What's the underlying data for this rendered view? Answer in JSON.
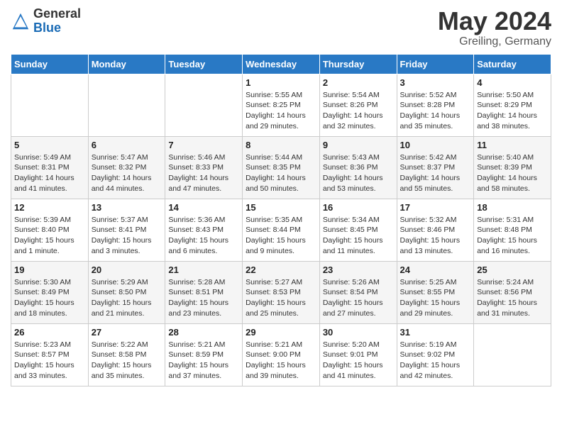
{
  "header": {
    "logo_general": "General",
    "logo_blue": "Blue",
    "title": "May 2024",
    "location": "Greiling, Germany"
  },
  "days_of_week": [
    "Sunday",
    "Monday",
    "Tuesday",
    "Wednesday",
    "Thursday",
    "Friday",
    "Saturday"
  ],
  "weeks": [
    [
      {
        "day": "",
        "info": ""
      },
      {
        "day": "",
        "info": ""
      },
      {
        "day": "",
        "info": ""
      },
      {
        "day": "1",
        "info": "Sunrise: 5:55 AM\nSunset: 8:25 PM\nDaylight: 14 hours\nand 29 minutes."
      },
      {
        "day": "2",
        "info": "Sunrise: 5:54 AM\nSunset: 8:26 PM\nDaylight: 14 hours\nand 32 minutes."
      },
      {
        "day": "3",
        "info": "Sunrise: 5:52 AM\nSunset: 8:28 PM\nDaylight: 14 hours\nand 35 minutes."
      },
      {
        "day": "4",
        "info": "Sunrise: 5:50 AM\nSunset: 8:29 PM\nDaylight: 14 hours\nand 38 minutes."
      }
    ],
    [
      {
        "day": "5",
        "info": "Sunrise: 5:49 AM\nSunset: 8:31 PM\nDaylight: 14 hours\nand 41 minutes."
      },
      {
        "day": "6",
        "info": "Sunrise: 5:47 AM\nSunset: 8:32 PM\nDaylight: 14 hours\nand 44 minutes."
      },
      {
        "day": "7",
        "info": "Sunrise: 5:46 AM\nSunset: 8:33 PM\nDaylight: 14 hours\nand 47 minutes."
      },
      {
        "day": "8",
        "info": "Sunrise: 5:44 AM\nSunset: 8:35 PM\nDaylight: 14 hours\nand 50 minutes."
      },
      {
        "day": "9",
        "info": "Sunrise: 5:43 AM\nSunset: 8:36 PM\nDaylight: 14 hours\nand 53 minutes."
      },
      {
        "day": "10",
        "info": "Sunrise: 5:42 AM\nSunset: 8:37 PM\nDaylight: 14 hours\nand 55 minutes."
      },
      {
        "day": "11",
        "info": "Sunrise: 5:40 AM\nSunset: 8:39 PM\nDaylight: 14 hours\nand 58 minutes."
      }
    ],
    [
      {
        "day": "12",
        "info": "Sunrise: 5:39 AM\nSunset: 8:40 PM\nDaylight: 15 hours\nand 1 minute."
      },
      {
        "day": "13",
        "info": "Sunrise: 5:37 AM\nSunset: 8:41 PM\nDaylight: 15 hours\nand 3 minutes."
      },
      {
        "day": "14",
        "info": "Sunrise: 5:36 AM\nSunset: 8:43 PM\nDaylight: 15 hours\nand 6 minutes."
      },
      {
        "day": "15",
        "info": "Sunrise: 5:35 AM\nSunset: 8:44 PM\nDaylight: 15 hours\nand 9 minutes."
      },
      {
        "day": "16",
        "info": "Sunrise: 5:34 AM\nSunset: 8:45 PM\nDaylight: 15 hours\nand 11 minutes."
      },
      {
        "day": "17",
        "info": "Sunrise: 5:32 AM\nSunset: 8:46 PM\nDaylight: 15 hours\nand 13 minutes."
      },
      {
        "day": "18",
        "info": "Sunrise: 5:31 AM\nSunset: 8:48 PM\nDaylight: 15 hours\nand 16 minutes."
      }
    ],
    [
      {
        "day": "19",
        "info": "Sunrise: 5:30 AM\nSunset: 8:49 PM\nDaylight: 15 hours\nand 18 minutes."
      },
      {
        "day": "20",
        "info": "Sunrise: 5:29 AM\nSunset: 8:50 PM\nDaylight: 15 hours\nand 21 minutes."
      },
      {
        "day": "21",
        "info": "Sunrise: 5:28 AM\nSunset: 8:51 PM\nDaylight: 15 hours\nand 23 minutes."
      },
      {
        "day": "22",
        "info": "Sunrise: 5:27 AM\nSunset: 8:53 PM\nDaylight: 15 hours\nand 25 minutes."
      },
      {
        "day": "23",
        "info": "Sunrise: 5:26 AM\nSunset: 8:54 PM\nDaylight: 15 hours\nand 27 minutes."
      },
      {
        "day": "24",
        "info": "Sunrise: 5:25 AM\nSunset: 8:55 PM\nDaylight: 15 hours\nand 29 minutes."
      },
      {
        "day": "25",
        "info": "Sunrise: 5:24 AM\nSunset: 8:56 PM\nDaylight: 15 hours\nand 31 minutes."
      }
    ],
    [
      {
        "day": "26",
        "info": "Sunrise: 5:23 AM\nSunset: 8:57 PM\nDaylight: 15 hours\nand 33 minutes."
      },
      {
        "day": "27",
        "info": "Sunrise: 5:22 AM\nSunset: 8:58 PM\nDaylight: 15 hours\nand 35 minutes."
      },
      {
        "day": "28",
        "info": "Sunrise: 5:21 AM\nSunset: 8:59 PM\nDaylight: 15 hours\nand 37 minutes."
      },
      {
        "day": "29",
        "info": "Sunrise: 5:21 AM\nSunset: 9:00 PM\nDaylight: 15 hours\nand 39 minutes."
      },
      {
        "day": "30",
        "info": "Sunrise: 5:20 AM\nSunset: 9:01 PM\nDaylight: 15 hours\nand 41 minutes."
      },
      {
        "day": "31",
        "info": "Sunrise: 5:19 AM\nSunset: 9:02 PM\nDaylight: 15 hours\nand 42 minutes."
      },
      {
        "day": "",
        "info": ""
      }
    ]
  ]
}
